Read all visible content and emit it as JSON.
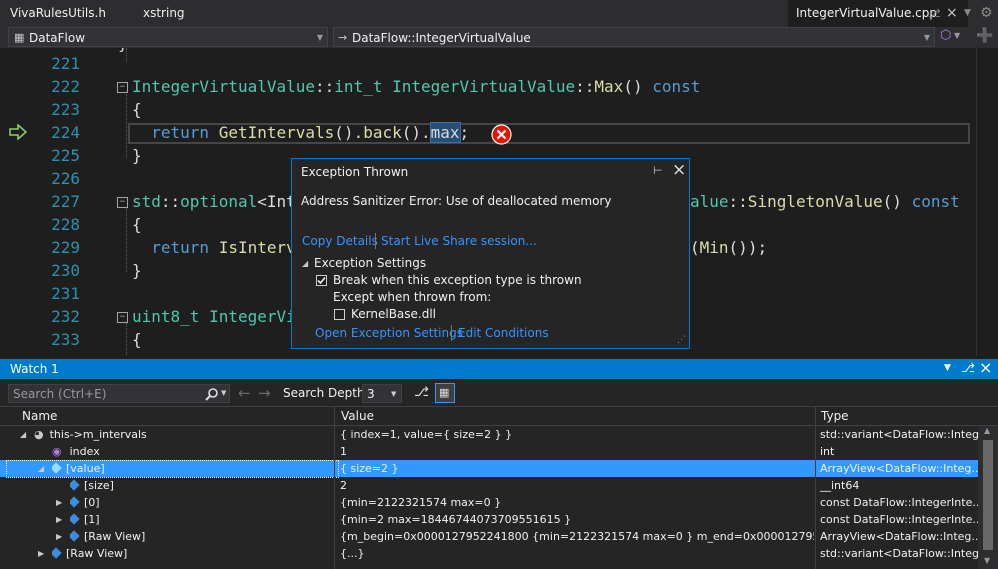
{
  "tabs": {
    "left1": "VivaRulesUtils.h",
    "left2": "xstring",
    "active": "IntegerVirtualValue.cpp"
  },
  "nav": {
    "scope": "DataFlow",
    "member": "DataFlow::IntegerVirtualValue"
  },
  "editor": {
    "lines": [
      "221",
      "222",
      "223",
      "224",
      "225",
      "226",
      "227",
      "228",
      "229",
      "230",
      "231",
      "232",
      "233"
    ],
    "code": {
      "l222_type": "IntegerVirtualValue",
      "l222_sep1": "::",
      "l222_ret": "int_t",
      "l222_sp": " ",
      "l222_cls": "IntegerVirtualValue",
      "l222_sep2": "::",
      "l222_fn": "Max",
      "l222_paren": "()",
      "l222_const": "const",
      "brace_open": "{",
      "brace_close": "}",
      "l224_return": "return",
      "l224_call": "GetIntervals",
      "l224_p1": "().",
      "l224_back": "back",
      "l224_p2": "().",
      "l224_max": "max",
      "l224_end": ";",
      "l227_ns": "std",
      "l227_sep": "::",
      "l227_opt": "optional",
      "l227_lt": "<Int",
      "l227_tail_ty": "alue",
      "l227_tail_sep": "::",
      "l227_tail_fn": "SingletonValue",
      "l227_tail_paren": "()",
      "l227_tail_const": "const",
      "l229_return": "return",
      "l229_call": "IsInterv",
      "l229_tail_a": "(",
      "l229_tail_fn": "Min",
      "l229_tail_b": "());",
      "l232_ty": "uint8_t",
      "l232_cls": "IntegerVi"
    }
  },
  "popup": {
    "title": "Exception Thrown",
    "message": "Address Sanitizer Error: Use of deallocated memory",
    "copy_details": "Copy Details",
    "live_share": "Start Live Share session...",
    "settings_heading": "Exception Settings",
    "break_when": "Break when this exception type is thrown",
    "except_when": "Except when thrown from:",
    "module": "KernelBase.dll",
    "open_settings": "Open Exception Settings",
    "edit_conditions": "Edit Conditions",
    "break_checked": true,
    "module_checked": false
  },
  "watch": {
    "title": "Watch 1",
    "search_placeholder": "Search (Ctrl+E)",
    "search_depth_label": "Search Depth:",
    "search_depth_value": "3",
    "columns": {
      "name": "Name",
      "value": "Value",
      "type": "Type"
    },
    "rows": [
      {
        "name": "this->m_intervals",
        "value": "{ index=1, value={ size=2 } }",
        "type": "std::variant<DataFlow::Integ..."
      },
      {
        "name": "index",
        "value": "1",
        "type": "int"
      },
      {
        "name": "[value]",
        "value": "{ size=2 }",
        "type": "ArrayView<DataFlow::Integ..."
      },
      {
        "name": "[size]",
        "value": "2",
        "type": "__int64"
      },
      {
        "name": "[0]",
        "value": "{min=2122321574 max=0 }",
        "type": "const DataFlow::IntegerInte..."
      },
      {
        "name": "[1]",
        "value": "{min=2 max=18446744073709551615 }",
        "type": "const DataFlow::IntegerInte..."
      },
      {
        "name": "[Raw View]",
        "value": "{m_begin=0x0000127952241800 {min=2122321574 max=0 } m_end=0x0000127952241840...",
        "type": "ArrayView<DataFlow::Integ..."
      },
      {
        "name": "[Raw View]",
        "value": "{...}",
        "type": "std::variant<DataFlow::Integ..."
      }
    ]
  },
  "colors": {
    "accent": "#007acc",
    "selection": "#3399ff",
    "error": "#e51400"
  },
  "icons": [
    "pin-icon",
    "close-icon",
    "search-icon",
    "back-arrow-icon",
    "forward-arrow-icon",
    "next-statement-arrow-icon",
    "error-icon",
    "cube-icon"
  ]
}
